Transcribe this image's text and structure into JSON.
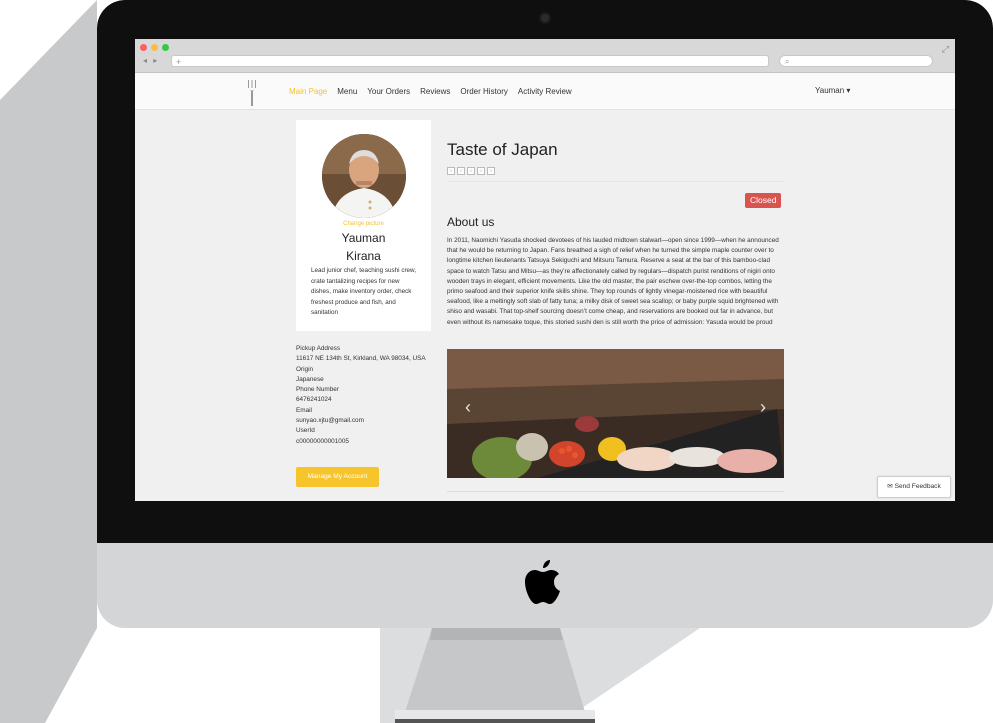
{
  "browser": {
    "url_placeholder": "+",
    "search_placeholder": "",
    "nav_arrows": "◂ ▸",
    "expand_icon": "⤢"
  },
  "navbar": {
    "items": [
      "Main Page",
      "Menu",
      "Your Orders",
      "Reviews",
      "Order History",
      "Activity Review"
    ],
    "active_index": 0,
    "user": "Yauman ▾"
  },
  "profile": {
    "change_picture": "Change picture",
    "first_name": "Yauman",
    "last_name": "Kirana",
    "bio": "Lead junior chef, teaching sushi crew, crate tantalizing recipes for new dishes, make inventory order, check freshest produce and fish, and sanitation"
  },
  "details": [
    {
      "label": "Pickup Address",
      "value": "11617 NE 134th St, Kirkland, WA 98034, USA"
    },
    {
      "label": "Origin",
      "value": "Japanese"
    },
    {
      "label": "Phone Number",
      "value": "6476241024"
    },
    {
      "label": "Email",
      "value": "sunyao.xjtu@gmail.com"
    },
    {
      "label": "UserId",
      "value": "c00000000001005"
    }
  ],
  "manage_button": "Manage My Account",
  "restaurant": {
    "title": "Taste of Japan",
    "rating": 0,
    "rating_max": 5,
    "status": "Closed",
    "about_heading": "About us",
    "about_text": "In 2011, Naomichi Yasuda shocked devotees of his lauded midtown stalwart—open since 1999—when he announced that he would be returning to Japan. Fans breathed a sigh of relief when he turned the simple maple counter over to longtime kitchen lieutenants Tatsuya Sekiguchi and Mitsuru Tamura. Reserve a seat at the bar of this bamboo-clad space to watch Tatsu and Mitsu—as they’re affectionately called by regulars—dispatch purist renditions of nigiri onto wooden trays in elegant, efficient movements. Like the old master, the pair eschew over-the-top combos, letting the primo seafood and their superior knife skills shine. They top rounds of lightly vinegar-moistened rice with beautiful seafood, like a meltingly soft slab of fatty tuna; a milky disk of sweet sea scallop; or baby purple squid brightened with shiso and wasabi. That top-shelf sourcing doesn’t come cheap, and reservations are booked out far in advance, but even without its namesake toque, this storied sushi den is still worth the price of admission: Yasuda would be proud"
  },
  "carousel": {
    "prev": "‹",
    "next": "›"
  },
  "feedback_button": "✉ Send Feedback",
  "colors": {
    "accent": "#f7c52b",
    "closed": "#d9534f"
  }
}
